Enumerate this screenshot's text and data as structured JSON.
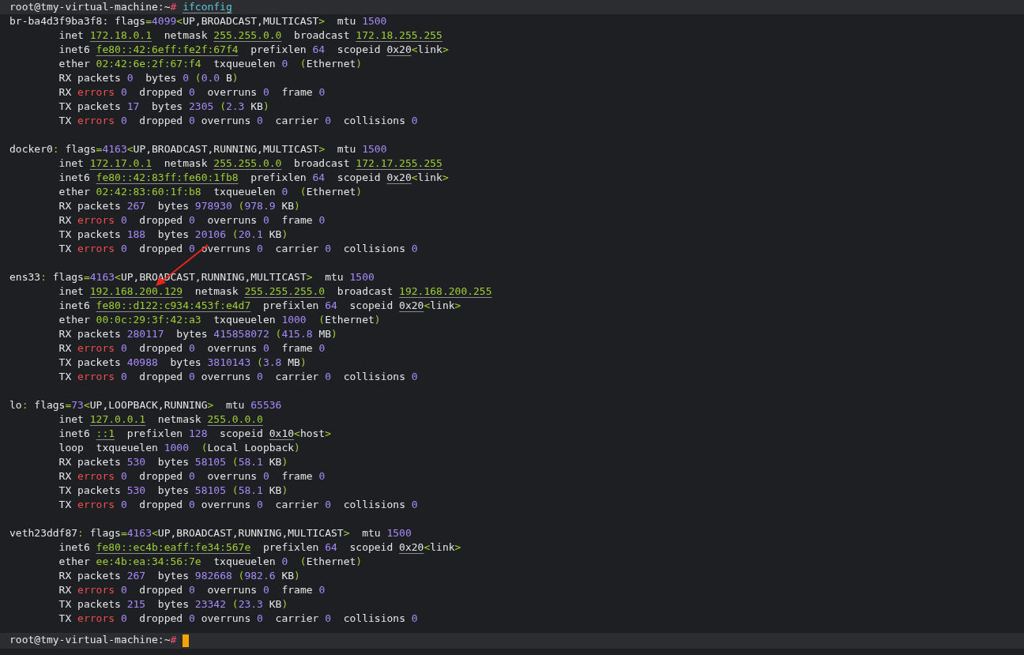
{
  "prompt_top": [
    {
      "text": "root@tmy-virtual-machine:~",
      "kind": "plain"
    },
    {
      "text": "# ",
      "kind": "hash"
    },
    {
      "text": "ifconfig",
      "kind": "command"
    }
  ],
  "interfaces": [
    {
      "lines": [
        [
          {
            "text": "br-ba4d3f9ba3f8: flags",
            "kind": "plain"
          },
          {
            "text": "=",
            "kind": "sym"
          },
          {
            "text": "4099",
            "kind": "num"
          },
          {
            "text": "<",
            "kind": "sym"
          },
          {
            "text": "UP,BROADCAST,MULTICAST",
            "kind": "plain"
          },
          {
            "text": ">",
            "kind": "sym"
          },
          {
            "text": "  mtu ",
            "kind": "plain"
          },
          {
            "text": "1500",
            "kind": "num"
          }
        ],
        [
          {
            "text": "        inet ",
            "kind": "plain"
          },
          {
            "text": "172.18.0.1",
            "kind": "addr"
          },
          {
            "text": "  netmask ",
            "kind": "plain"
          },
          {
            "text": "255.255.0.0",
            "kind": "addr"
          },
          {
            "text": "  broadcast ",
            "kind": "plain"
          },
          {
            "text": "172.18.255.255",
            "kind": "addr"
          }
        ],
        [
          {
            "text": "        inet6 ",
            "kind": "plain"
          },
          {
            "text": "fe80::42:6eff:fe2f:67f4",
            "kind": "addr"
          },
          {
            "text": "  prefixlen ",
            "kind": "plain"
          },
          {
            "text": "64",
            "kind": "num"
          },
          {
            "text": "  scopeid ",
            "kind": "plain"
          },
          {
            "text": "0x20",
            "kind": "hex"
          },
          {
            "text": "<",
            "kind": "sym"
          },
          {
            "text": "link",
            "kind": "plain"
          },
          {
            "text": ">",
            "kind": "sym"
          }
        ],
        [
          {
            "text": "        ether ",
            "kind": "plain"
          },
          {
            "text": "02:42:6e:2f:67:f4",
            "kind": "mac"
          },
          {
            "text": "  txqueuelen ",
            "kind": "plain"
          },
          {
            "text": "0",
            "kind": "num"
          },
          {
            "text": "  (",
            "kind": "sym"
          },
          {
            "text": "Ethernet",
            "kind": "plain"
          },
          {
            "text": ")",
            "kind": "sym"
          }
        ],
        [
          {
            "text": "        RX packets ",
            "kind": "plain"
          },
          {
            "text": "0",
            "kind": "num"
          },
          {
            "text": "  bytes ",
            "kind": "plain"
          },
          {
            "text": "0",
            "kind": "num"
          },
          {
            "text": " (",
            "kind": "sym"
          },
          {
            "text": "0.0",
            "kind": "num"
          },
          {
            "text": " B",
            "kind": "plain"
          },
          {
            "text": ")",
            "kind": "sym"
          }
        ],
        [
          {
            "text": "        RX ",
            "kind": "plain"
          },
          {
            "text": "errors",
            "kind": "err"
          },
          {
            "text": " 0",
            "kind": "num"
          },
          {
            "text": "  dropped ",
            "kind": "plain"
          },
          {
            "text": "0",
            "kind": "num"
          },
          {
            "text": "  overruns ",
            "kind": "plain"
          },
          {
            "text": "0",
            "kind": "num"
          },
          {
            "text": "  frame ",
            "kind": "plain"
          },
          {
            "text": "0",
            "kind": "num"
          }
        ],
        [
          {
            "text": "        TX packets ",
            "kind": "plain"
          },
          {
            "text": "17",
            "kind": "num"
          },
          {
            "text": "  bytes ",
            "kind": "plain"
          },
          {
            "text": "2305",
            "kind": "num"
          },
          {
            "text": " (",
            "kind": "sym"
          },
          {
            "text": "2.3",
            "kind": "num"
          },
          {
            "text": " KB",
            "kind": "plain"
          },
          {
            "text": ")",
            "kind": "sym"
          }
        ],
        [
          {
            "text": "        TX ",
            "kind": "plain"
          },
          {
            "text": "errors",
            "kind": "err"
          },
          {
            "text": " 0",
            "kind": "num"
          },
          {
            "text": "  dropped ",
            "kind": "plain"
          },
          {
            "text": "0",
            "kind": "num"
          },
          {
            "text": " overruns ",
            "kind": "plain"
          },
          {
            "text": "0",
            "kind": "num"
          },
          {
            "text": "  carrier ",
            "kind": "plain"
          },
          {
            "text": "0",
            "kind": "num"
          },
          {
            "text": "  collisions ",
            "kind": "plain"
          },
          {
            "text": "0",
            "kind": "num"
          }
        ]
      ]
    },
    {
      "lines": [
        [
          {
            "text": "docker0",
            "kind": "plain"
          },
          {
            "text": ":",
            "kind": "sym"
          },
          {
            "text": " flags",
            "kind": "plain"
          },
          {
            "text": "=",
            "kind": "sym"
          },
          {
            "text": "4163",
            "kind": "num"
          },
          {
            "text": "<",
            "kind": "sym"
          },
          {
            "text": "UP,BROADCAST,RUNNING,MULTICAST",
            "kind": "plain"
          },
          {
            "text": ">",
            "kind": "sym"
          },
          {
            "text": "  mtu ",
            "kind": "plain"
          },
          {
            "text": "1500",
            "kind": "num"
          }
        ],
        [
          {
            "text": "        inet ",
            "kind": "plain"
          },
          {
            "text": "172.17.0.1",
            "kind": "addr"
          },
          {
            "text": "  netmask ",
            "kind": "plain"
          },
          {
            "text": "255.255.0.0",
            "kind": "addr"
          },
          {
            "text": "  broadcast ",
            "kind": "plain"
          },
          {
            "text": "172.17.255.255",
            "kind": "addr"
          }
        ],
        [
          {
            "text": "        inet6 ",
            "kind": "plain"
          },
          {
            "text": "fe80::42:83ff:fe60:1fb8",
            "kind": "addr"
          },
          {
            "text": "  prefixlen ",
            "kind": "plain"
          },
          {
            "text": "64",
            "kind": "num"
          },
          {
            "text": "  scopeid ",
            "kind": "plain"
          },
          {
            "text": "0x20",
            "kind": "hex"
          },
          {
            "text": "<",
            "kind": "sym"
          },
          {
            "text": "link",
            "kind": "plain"
          },
          {
            "text": ">",
            "kind": "sym"
          }
        ],
        [
          {
            "text": "        ether ",
            "kind": "plain"
          },
          {
            "text": "02:42:83:60:1f:b8",
            "kind": "mac"
          },
          {
            "text": "  txqueuelen ",
            "kind": "plain"
          },
          {
            "text": "0",
            "kind": "num"
          },
          {
            "text": "  (",
            "kind": "sym"
          },
          {
            "text": "Ethernet",
            "kind": "plain"
          },
          {
            "text": ")",
            "kind": "sym"
          }
        ],
        [
          {
            "text": "        RX packets ",
            "kind": "plain"
          },
          {
            "text": "267",
            "kind": "num"
          },
          {
            "text": "  bytes ",
            "kind": "plain"
          },
          {
            "text": "978930",
            "kind": "num"
          },
          {
            "text": " (",
            "kind": "sym"
          },
          {
            "text": "978.9",
            "kind": "num"
          },
          {
            "text": " KB",
            "kind": "plain"
          },
          {
            "text": ")",
            "kind": "sym"
          }
        ],
        [
          {
            "text": "        RX ",
            "kind": "plain"
          },
          {
            "text": "errors",
            "kind": "err"
          },
          {
            "text": " 0",
            "kind": "num"
          },
          {
            "text": "  dropped ",
            "kind": "plain"
          },
          {
            "text": "0",
            "kind": "num"
          },
          {
            "text": "  overruns ",
            "kind": "plain"
          },
          {
            "text": "0",
            "kind": "num"
          },
          {
            "text": "  frame ",
            "kind": "plain"
          },
          {
            "text": "0",
            "kind": "num"
          }
        ],
        [
          {
            "text": "        TX packets ",
            "kind": "plain"
          },
          {
            "text": "188",
            "kind": "num"
          },
          {
            "text": "  bytes ",
            "kind": "plain"
          },
          {
            "text": "20106",
            "kind": "num"
          },
          {
            "text": " (",
            "kind": "sym"
          },
          {
            "text": "20.1",
            "kind": "num"
          },
          {
            "text": " KB",
            "kind": "plain"
          },
          {
            "text": ")",
            "kind": "sym"
          }
        ],
        [
          {
            "text": "        TX ",
            "kind": "plain"
          },
          {
            "text": "errors",
            "kind": "err"
          },
          {
            "text": " 0",
            "kind": "num"
          },
          {
            "text": "  dropped ",
            "kind": "plain"
          },
          {
            "text": "0",
            "kind": "num"
          },
          {
            "text": " overruns ",
            "kind": "plain"
          },
          {
            "text": "0",
            "kind": "num"
          },
          {
            "text": "  carrier ",
            "kind": "plain"
          },
          {
            "text": "0",
            "kind": "num"
          },
          {
            "text": "  collisions ",
            "kind": "plain"
          },
          {
            "text": "0",
            "kind": "num"
          }
        ]
      ]
    },
    {
      "lines": [
        [
          {
            "text": "ens33",
            "kind": "plain"
          },
          {
            "text": ":",
            "kind": "sym"
          },
          {
            "text": " flags",
            "kind": "plain"
          },
          {
            "text": "=",
            "kind": "sym"
          },
          {
            "text": "4163",
            "kind": "num"
          },
          {
            "text": "<",
            "kind": "sym"
          },
          {
            "text": "UP,BROADCAST,RUNNING,MULTICAST",
            "kind": "plain"
          },
          {
            "text": ">",
            "kind": "sym"
          },
          {
            "text": "  mtu ",
            "kind": "plain"
          },
          {
            "text": "1500",
            "kind": "num"
          }
        ],
        [
          {
            "text": "        inet ",
            "kind": "plain"
          },
          {
            "text": "192.168.200.129",
            "kind": "addr"
          },
          {
            "text": "  netmask ",
            "kind": "plain"
          },
          {
            "text": "255.255.255.0",
            "kind": "addr"
          },
          {
            "text": "  broadcast ",
            "kind": "plain"
          },
          {
            "text": "192.168.200.255",
            "kind": "addr"
          }
        ],
        [
          {
            "text": "        inet6 ",
            "kind": "plain"
          },
          {
            "text": "fe80::d122:c934:453f:e4d7",
            "kind": "addr"
          },
          {
            "text": "  prefixlen ",
            "kind": "plain"
          },
          {
            "text": "64",
            "kind": "num"
          },
          {
            "text": "  scopeid ",
            "kind": "plain"
          },
          {
            "text": "0x20",
            "kind": "hex"
          },
          {
            "text": "<",
            "kind": "sym"
          },
          {
            "text": "link",
            "kind": "plain"
          },
          {
            "text": ">",
            "kind": "sym"
          }
        ],
        [
          {
            "text": "        ether ",
            "kind": "plain"
          },
          {
            "text": "00:0c:29:3f:42:a3",
            "kind": "mac"
          },
          {
            "text": "  txqueuelen ",
            "kind": "plain"
          },
          {
            "text": "1000",
            "kind": "num"
          },
          {
            "text": "  (",
            "kind": "sym"
          },
          {
            "text": "Ethernet",
            "kind": "plain"
          },
          {
            "text": ")",
            "kind": "sym"
          }
        ],
        [
          {
            "text": "        RX packets ",
            "kind": "plain"
          },
          {
            "text": "280117",
            "kind": "num"
          },
          {
            "text": "  bytes ",
            "kind": "plain"
          },
          {
            "text": "415858072",
            "kind": "num"
          },
          {
            "text": " (",
            "kind": "sym"
          },
          {
            "text": "415.8",
            "kind": "num"
          },
          {
            "text": " MB",
            "kind": "plain"
          },
          {
            "text": ")",
            "kind": "sym"
          }
        ],
        [
          {
            "text": "        RX ",
            "kind": "plain"
          },
          {
            "text": "errors",
            "kind": "err"
          },
          {
            "text": " 0",
            "kind": "num"
          },
          {
            "text": "  dropped ",
            "kind": "plain"
          },
          {
            "text": "0",
            "kind": "num"
          },
          {
            "text": "  overruns ",
            "kind": "plain"
          },
          {
            "text": "0",
            "kind": "num"
          },
          {
            "text": "  frame ",
            "kind": "plain"
          },
          {
            "text": "0",
            "kind": "num"
          }
        ],
        [
          {
            "text": "        TX packets ",
            "kind": "plain"
          },
          {
            "text": "40988",
            "kind": "num"
          },
          {
            "text": "  bytes ",
            "kind": "plain"
          },
          {
            "text": "3810143",
            "kind": "num"
          },
          {
            "text": " (",
            "kind": "sym"
          },
          {
            "text": "3.8",
            "kind": "num"
          },
          {
            "text": " MB",
            "kind": "plain"
          },
          {
            "text": ")",
            "kind": "sym"
          }
        ],
        [
          {
            "text": "        TX ",
            "kind": "plain"
          },
          {
            "text": "errors",
            "kind": "err"
          },
          {
            "text": " 0",
            "kind": "num"
          },
          {
            "text": "  dropped ",
            "kind": "plain"
          },
          {
            "text": "0",
            "kind": "num"
          },
          {
            "text": " overruns ",
            "kind": "plain"
          },
          {
            "text": "0",
            "kind": "num"
          },
          {
            "text": "  carrier ",
            "kind": "plain"
          },
          {
            "text": "0",
            "kind": "num"
          },
          {
            "text": "  collisions ",
            "kind": "plain"
          },
          {
            "text": "0",
            "kind": "num"
          }
        ]
      ]
    },
    {
      "lines": [
        [
          {
            "text": "lo",
            "kind": "plain"
          },
          {
            "text": ":",
            "kind": "sym"
          },
          {
            "text": " flags",
            "kind": "plain"
          },
          {
            "text": "=",
            "kind": "sym"
          },
          {
            "text": "73",
            "kind": "num"
          },
          {
            "text": "<",
            "kind": "sym"
          },
          {
            "text": "UP,LOOPBACK,RUNNING",
            "kind": "plain"
          },
          {
            "text": ">",
            "kind": "sym"
          },
          {
            "text": "  mtu ",
            "kind": "plain"
          },
          {
            "text": "65536",
            "kind": "num"
          }
        ],
        [
          {
            "text": "        inet ",
            "kind": "plain"
          },
          {
            "text": "127.0.0.1",
            "kind": "addr"
          },
          {
            "text": "  netmask ",
            "kind": "plain"
          },
          {
            "text": "255.0.0.0",
            "kind": "addr"
          }
        ],
        [
          {
            "text": "        inet6 ",
            "kind": "plain"
          },
          {
            "text": "::1",
            "kind": "addr"
          },
          {
            "text": "  prefixlen ",
            "kind": "plain"
          },
          {
            "text": "128",
            "kind": "num"
          },
          {
            "text": "  scopeid ",
            "kind": "plain"
          },
          {
            "text": "0x10",
            "kind": "hex"
          },
          {
            "text": "<",
            "kind": "sym"
          },
          {
            "text": "host",
            "kind": "plain"
          },
          {
            "text": ">",
            "kind": "sym"
          }
        ],
        [
          {
            "text": "        loop  txqueuelen ",
            "kind": "plain"
          },
          {
            "text": "1000",
            "kind": "num"
          },
          {
            "text": "  (",
            "kind": "sym"
          },
          {
            "text": "Local Loopback",
            "kind": "plain"
          },
          {
            "text": ")",
            "kind": "sym"
          }
        ],
        [
          {
            "text": "        RX packets ",
            "kind": "plain"
          },
          {
            "text": "530",
            "kind": "num"
          },
          {
            "text": "  bytes ",
            "kind": "plain"
          },
          {
            "text": "58105",
            "kind": "num"
          },
          {
            "text": " (",
            "kind": "sym"
          },
          {
            "text": "58.1",
            "kind": "num"
          },
          {
            "text": " KB",
            "kind": "plain"
          },
          {
            "text": ")",
            "kind": "sym"
          }
        ],
        [
          {
            "text": "        RX ",
            "kind": "plain"
          },
          {
            "text": "errors",
            "kind": "err"
          },
          {
            "text": " 0",
            "kind": "num"
          },
          {
            "text": "  dropped ",
            "kind": "plain"
          },
          {
            "text": "0",
            "kind": "num"
          },
          {
            "text": "  overruns ",
            "kind": "plain"
          },
          {
            "text": "0",
            "kind": "num"
          },
          {
            "text": "  frame ",
            "kind": "plain"
          },
          {
            "text": "0",
            "kind": "num"
          }
        ],
        [
          {
            "text": "        TX packets ",
            "kind": "plain"
          },
          {
            "text": "530",
            "kind": "num"
          },
          {
            "text": "  bytes ",
            "kind": "plain"
          },
          {
            "text": "58105",
            "kind": "num"
          },
          {
            "text": " (",
            "kind": "sym"
          },
          {
            "text": "58.1",
            "kind": "num"
          },
          {
            "text": " KB",
            "kind": "plain"
          },
          {
            "text": ")",
            "kind": "sym"
          }
        ],
        [
          {
            "text": "        TX ",
            "kind": "plain"
          },
          {
            "text": "errors",
            "kind": "err"
          },
          {
            "text": " 0",
            "kind": "num"
          },
          {
            "text": "  dropped ",
            "kind": "plain"
          },
          {
            "text": "0",
            "kind": "num"
          },
          {
            "text": " overruns ",
            "kind": "plain"
          },
          {
            "text": "0",
            "kind": "num"
          },
          {
            "text": "  carrier ",
            "kind": "plain"
          },
          {
            "text": "0",
            "kind": "num"
          },
          {
            "text": "  collisions ",
            "kind": "plain"
          },
          {
            "text": "0",
            "kind": "num"
          }
        ]
      ]
    },
    {
      "lines": [
        [
          {
            "text": "veth23ddf87",
            "kind": "plain"
          },
          {
            "text": ":",
            "kind": "sym"
          },
          {
            "text": " flags",
            "kind": "plain"
          },
          {
            "text": "=",
            "kind": "sym"
          },
          {
            "text": "4163",
            "kind": "num"
          },
          {
            "text": "<",
            "kind": "sym"
          },
          {
            "text": "UP,BROADCAST,RUNNING,MULTICAST",
            "kind": "plain"
          },
          {
            "text": ">",
            "kind": "sym"
          },
          {
            "text": "  mtu ",
            "kind": "plain"
          },
          {
            "text": "1500",
            "kind": "num"
          }
        ],
        [
          {
            "text": "        inet6 ",
            "kind": "plain"
          },
          {
            "text": "fe80::ec4b:eaff:fe34:567e",
            "kind": "addr"
          },
          {
            "text": "  prefixlen ",
            "kind": "plain"
          },
          {
            "text": "64",
            "kind": "num"
          },
          {
            "text": "  scopeid ",
            "kind": "plain"
          },
          {
            "text": "0x20",
            "kind": "hex"
          },
          {
            "text": "<",
            "kind": "sym"
          },
          {
            "text": "link",
            "kind": "plain"
          },
          {
            "text": ">",
            "kind": "sym"
          }
        ],
        [
          {
            "text": "        ether ",
            "kind": "plain"
          },
          {
            "text": "ee:4b:ea:34:56:7e",
            "kind": "mac"
          },
          {
            "text": "  txqueuelen ",
            "kind": "plain"
          },
          {
            "text": "0",
            "kind": "num"
          },
          {
            "text": "  (",
            "kind": "sym"
          },
          {
            "text": "Ethernet",
            "kind": "plain"
          },
          {
            "text": ")",
            "kind": "sym"
          }
        ],
        [
          {
            "text": "        RX packets ",
            "kind": "plain"
          },
          {
            "text": "267",
            "kind": "num"
          },
          {
            "text": "  bytes ",
            "kind": "plain"
          },
          {
            "text": "982668",
            "kind": "num"
          },
          {
            "text": " (",
            "kind": "sym"
          },
          {
            "text": "982.6",
            "kind": "num"
          },
          {
            "text": " KB",
            "kind": "plain"
          },
          {
            "text": ")",
            "kind": "sym"
          }
        ],
        [
          {
            "text": "        RX ",
            "kind": "plain"
          },
          {
            "text": "errors",
            "kind": "err"
          },
          {
            "text": " 0",
            "kind": "num"
          },
          {
            "text": "  dropped ",
            "kind": "plain"
          },
          {
            "text": "0",
            "kind": "num"
          },
          {
            "text": "  overruns ",
            "kind": "plain"
          },
          {
            "text": "0",
            "kind": "num"
          },
          {
            "text": "  frame ",
            "kind": "plain"
          },
          {
            "text": "0",
            "kind": "num"
          }
        ],
        [
          {
            "text": "        TX packets ",
            "kind": "plain"
          },
          {
            "text": "215",
            "kind": "num"
          },
          {
            "text": "  bytes ",
            "kind": "plain"
          },
          {
            "text": "23342",
            "kind": "num"
          },
          {
            "text": " (",
            "kind": "sym"
          },
          {
            "text": "23.3",
            "kind": "num"
          },
          {
            "text": " KB",
            "kind": "plain"
          },
          {
            "text": ")",
            "kind": "sym"
          }
        ],
        [
          {
            "text": "        TX ",
            "kind": "plain"
          },
          {
            "text": "errors",
            "kind": "err"
          },
          {
            "text": " 0",
            "kind": "num"
          },
          {
            "text": "  dropped ",
            "kind": "plain"
          },
          {
            "text": "0",
            "kind": "num"
          },
          {
            "text": " overruns ",
            "kind": "plain"
          },
          {
            "text": "0",
            "kind": "num"
          },
          {
            "text": "  carrier ",
            "kind": "plain"
          },
          {
            "text": "0",
            "kind": "num"
          },
          {
            "text": "  collisions ",
            "kind": "plain"
          },
          {
            "text": "0",
            "kind": "num"
          }
        ]
      ]
    }
  ],
  "prompt_bottom": [
    {
      "text": "root@tmy-virtual-machine:~",
      "kind": "plain"
    },
    {
      "text": "# ",
      "kind": "hash"
    }
  ]
}
